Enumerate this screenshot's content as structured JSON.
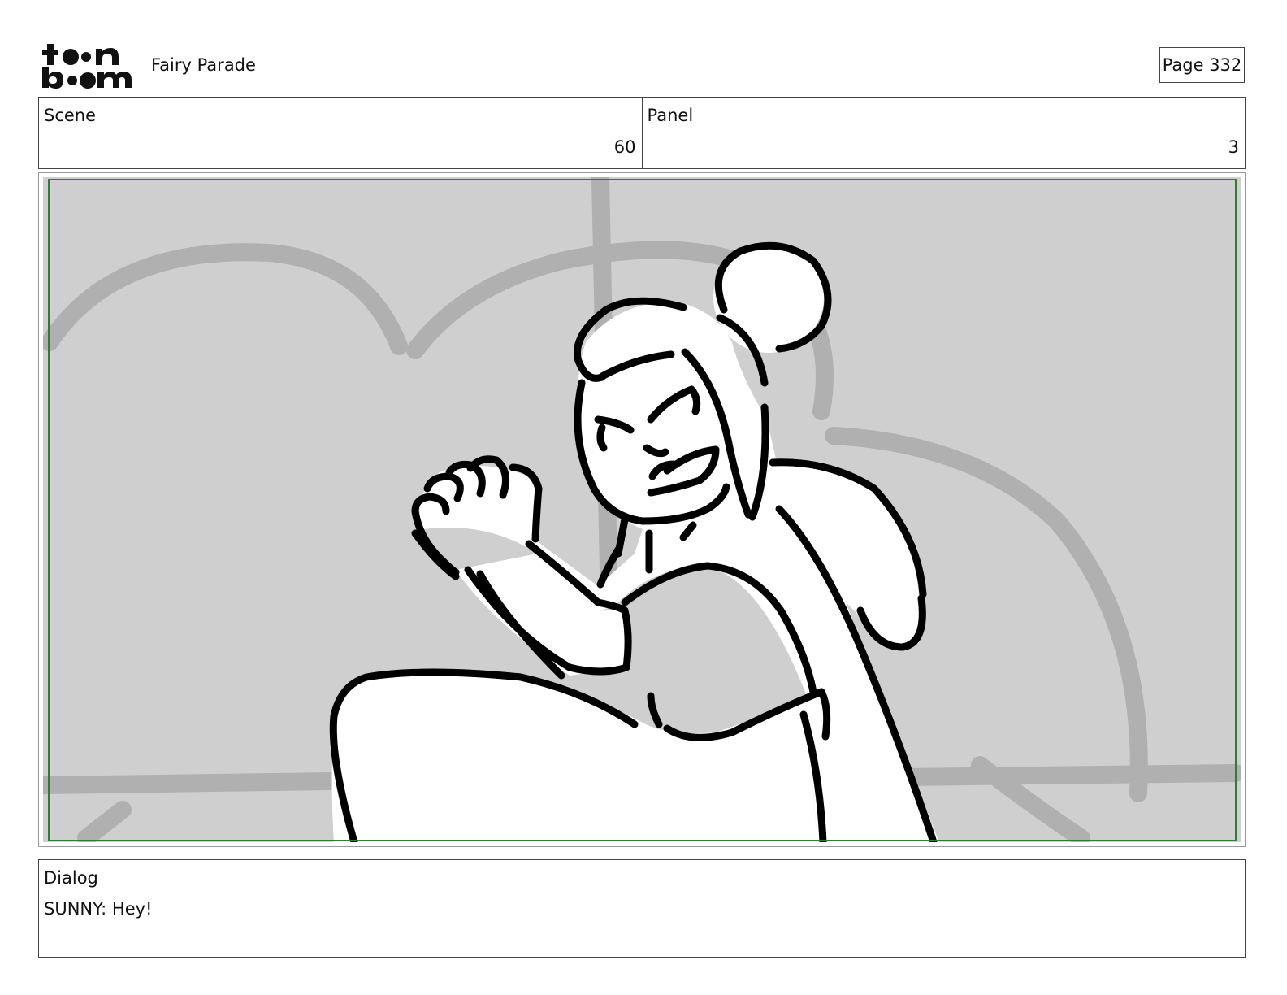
{
  "header": {
    "logo_text": "toon boom",
    "project_title": "Fairy Parade",
    "page_label": "Page 332"
  },
  "info": {
    "scene_label": "Scene",
    "scene_value": "60",
    "panel_label": "Panel",
    "panel_value": "3"
  },
  "dialog": {
    "label": "Dialog",
    "text": "SUNNY: Hey!"
  },
  "colors": {
    "safe_frame": "#2e7d32",
    "panel_background": "#cfcfcf"
  }
}
